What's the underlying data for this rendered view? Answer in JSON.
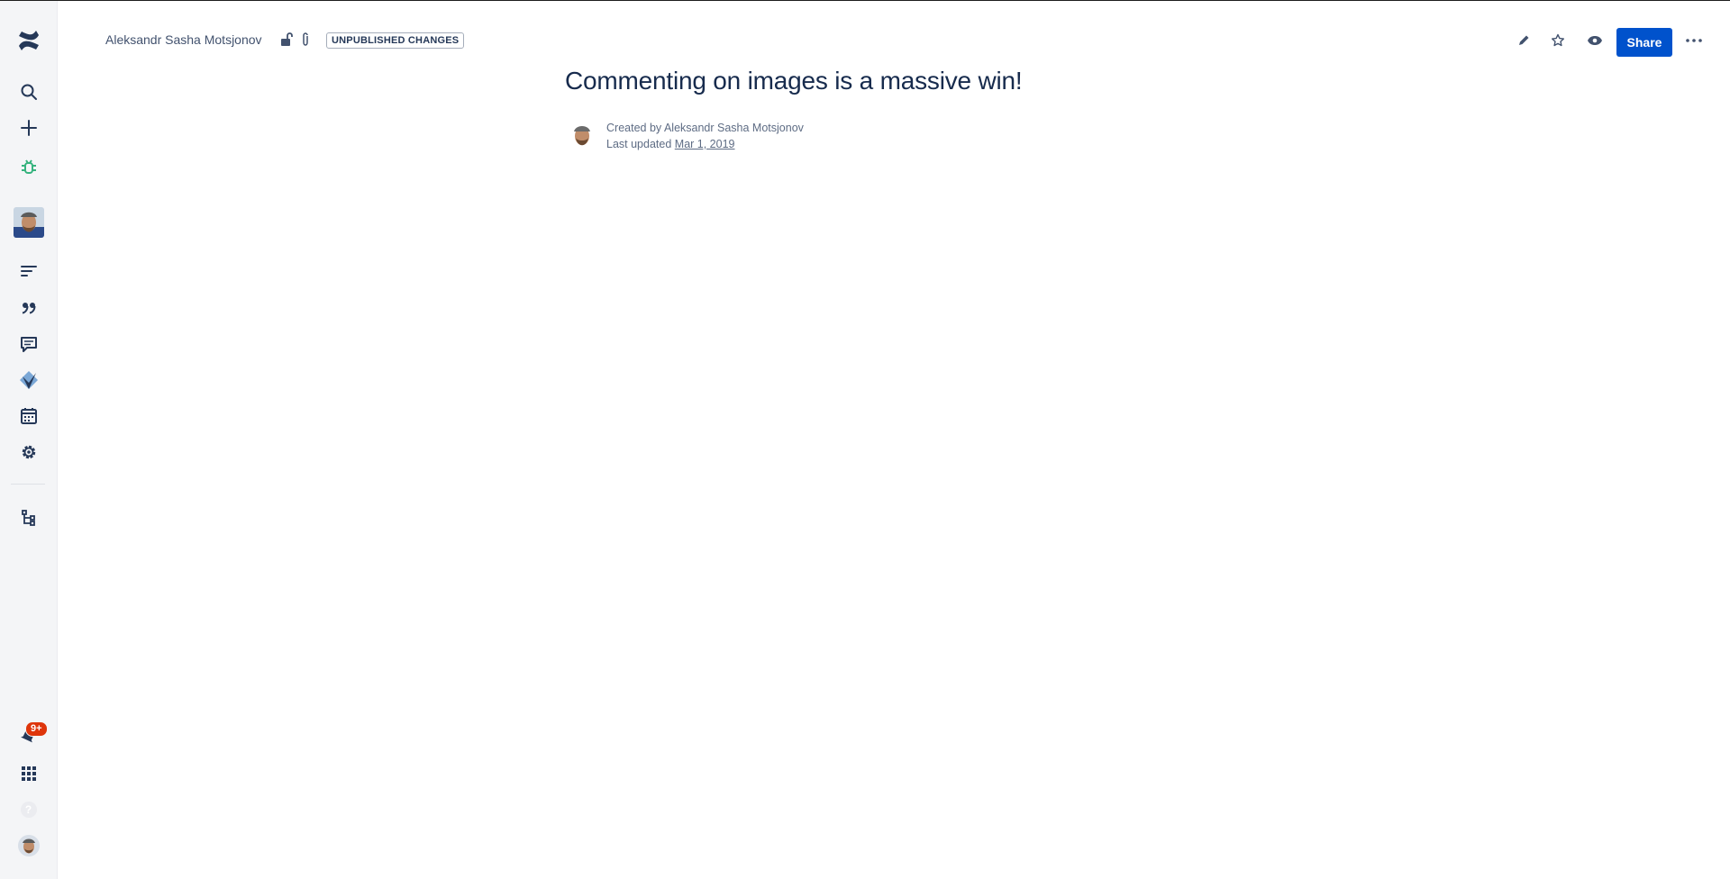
{
  "sidebar": {
    "items": [
      {
        "name": "confluence-logo",
        "icon": "confluence-logo-icon"
      },
      {
        "name": "search",
        "icon": "search-icon"
      },
      {
        "name": "create",
        "icon": "plus-icon"
      },
      {
        "name": "bug",
        "icon": "bug-icon"
      },
      {
        "name": "space-avatar",
        "icon": "avatar"
      },
      {
        "name": "pages",
        "icon": "list-icon"
      },
      {
        "name": "blog",
        "icon": "quote-icon"
      },
      {
        "name": "comments",
        "icon": "comment-icon"
      },
      {
        "name": "app",
        "icon": "app-icon"
      },
      {
        "name": "calendar",
        "icon": "calendar-icon"
      },
      {
        "name": "settings",
        "icon": "gear-icon"
      },
      {
        "name": "hierarchy",
        "icon": "hierarchy-icon"
      },
      {
        "name": "notifications",
        "icon": "bell-icon"
      },
      {
        "name": "app-switcher",
        "icon": "grid-icon"
      },
      {
        "name": "help",
        "icon": "help-icon"
      },
      {
        "name": "profile",
        "icon": "avatar"
      }
    ],
    "notification_badge": "9+",
    "help_glyph": "?"
  },
  "header": {
    "breadcrumb": "Aleksandr Sasha Motsjonov",
    "status": "UNPUBLISHED CHANGES",
    "share_label": "Share"
  },
  "page": {
    "title": "Commenting on images is a massive win!",
    "created_prefix": "Created by",
    "author": "Aleksandr Sasha Motsjonov",
    "updated_prefix": "Last updated",
    "updated_date": "Mar 1, 2019"
  },
  "colors": {
    "primary": "#0052cc",
    "sidebar_bg": "#f4f5f7",
    "text_dark": "#172b4d",
    "text_subtle": "#5e6c84",
    "bug_green": "#36b37e",
    "badge_red": "#de350b"
  }
}
